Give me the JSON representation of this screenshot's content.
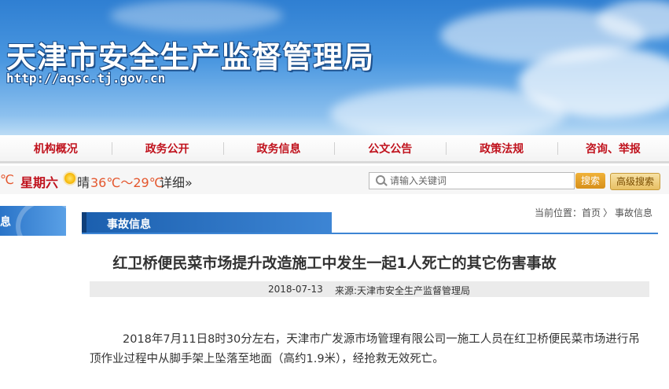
{
  "header": {
    "site_title": "天津市安全生产监督管理局",
    "site_url": "http://aqsc.tj.gov.cn"
  },
  "nav": {
    "items": [
      "机构概况",
      "政务公开",
      "政务信息",
      "公文公告",
      "政策法规",
      "咨询、举报"
    ]
  },
  "infobar": {
    "partial_temp": "℃",
    "weekday": "星期六",
    "weather_icon": "sun-icon",
    "weather": "晴",
    "temperature": "36℃～29℃",
    "detail_link": "详细»"
  },
  "search": {
    "placeholder": "请输入关键词",
    "button_label": "搜索",
    "advanced_label": "高级搜索"
  },
  "left_tab": {
    "label": "息"
  },
  "section": {
    "title": "事故信息"
  },
  "breadcrumb": {
    "prefix": "当前位置：",
    "home": "首页",
    "separator": "〉",
    "current": "事故信息"
  },
  "article": {
    "title": "红卫桥便民菜市场提升改造施工中发生一起1人死亡的其它伤害事故",
    "date": "2018-07-13",
    "source": "来源:天津市安全生产监督管理局",
    "body": "2018年7月11日8时30分左右，天津市广发源市场管理有限公司一施工人员在红卫桥便民菜市场进行吊顶作业过程中从脚手架上坠落至地面（高约1.9米），经抢救无效死亡。"
  },
  "colors": {
    "nav_text": "#c0121d",
    "banner_blue": "#2f7fd2",
    "section_blue": "#1b5fae",
    "search_button": "#e0a030"
  }
}
